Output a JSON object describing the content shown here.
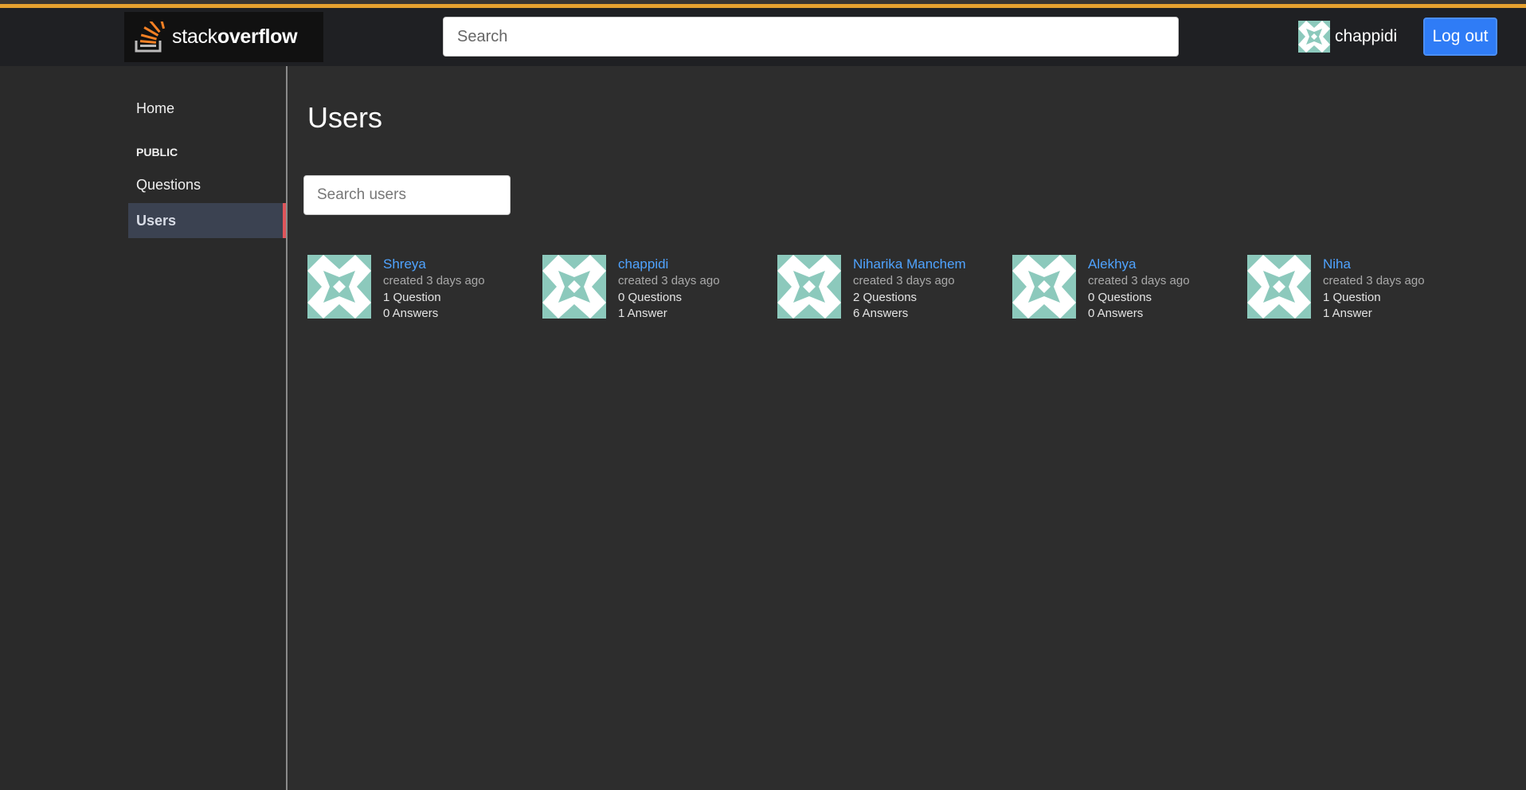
{
  "header": {
    "logo": {
      "prefix": "stack",
      "suffix": "overflow"
    },
    "search_placeholder": "Search",
    "user": {
      "name": "chappidi"
    },
    "logout_label": "Log out"
  },
  "sidebar": {
    "home": "Home",
    "section": "PUBLIC",
    "items": [
      {
        "label": "Questions"
      },
      {
        "label": "Users"
      }
    ]
  },
  "main": {
    "title": "Users",
    "search_placeholder": "Search users",
    "users": [
      {
        "name": "Shreya",
        "created": "created 3 days ago",
        "questions": "1 Question",
        "answers": "0 Answers"
      },
      {
        "name": "chappidi",
        "created": "created 3 days ago",
        "questions": "0 Questions",
        "answers": "1 Answer"
      },
      {
        "name": "Niharika Manchem",
        "created": "created 3 days ago",
        "questions": "2 Questions",
        "answers": "6 Answers"
      },
      {
        "name": "Alekhya",
        "created": "created 3 days ago",
        "questions": "0 Questions",
        "answers": "0 Answers"
      },
      {
        "name": "Niha",
        "created": "created 3 days ago",
        "questions": "1 Question",
        "answers": "1 Answer"
      }
    ]
  },
  "colors": {
    "accent": "#e7a12f",
    "link": "#4fa3ff",
    "logout": "#2f7cf6",
    "active_marker": "#e0555a",
    "avatar": "#8cc9bc"
  }
}
